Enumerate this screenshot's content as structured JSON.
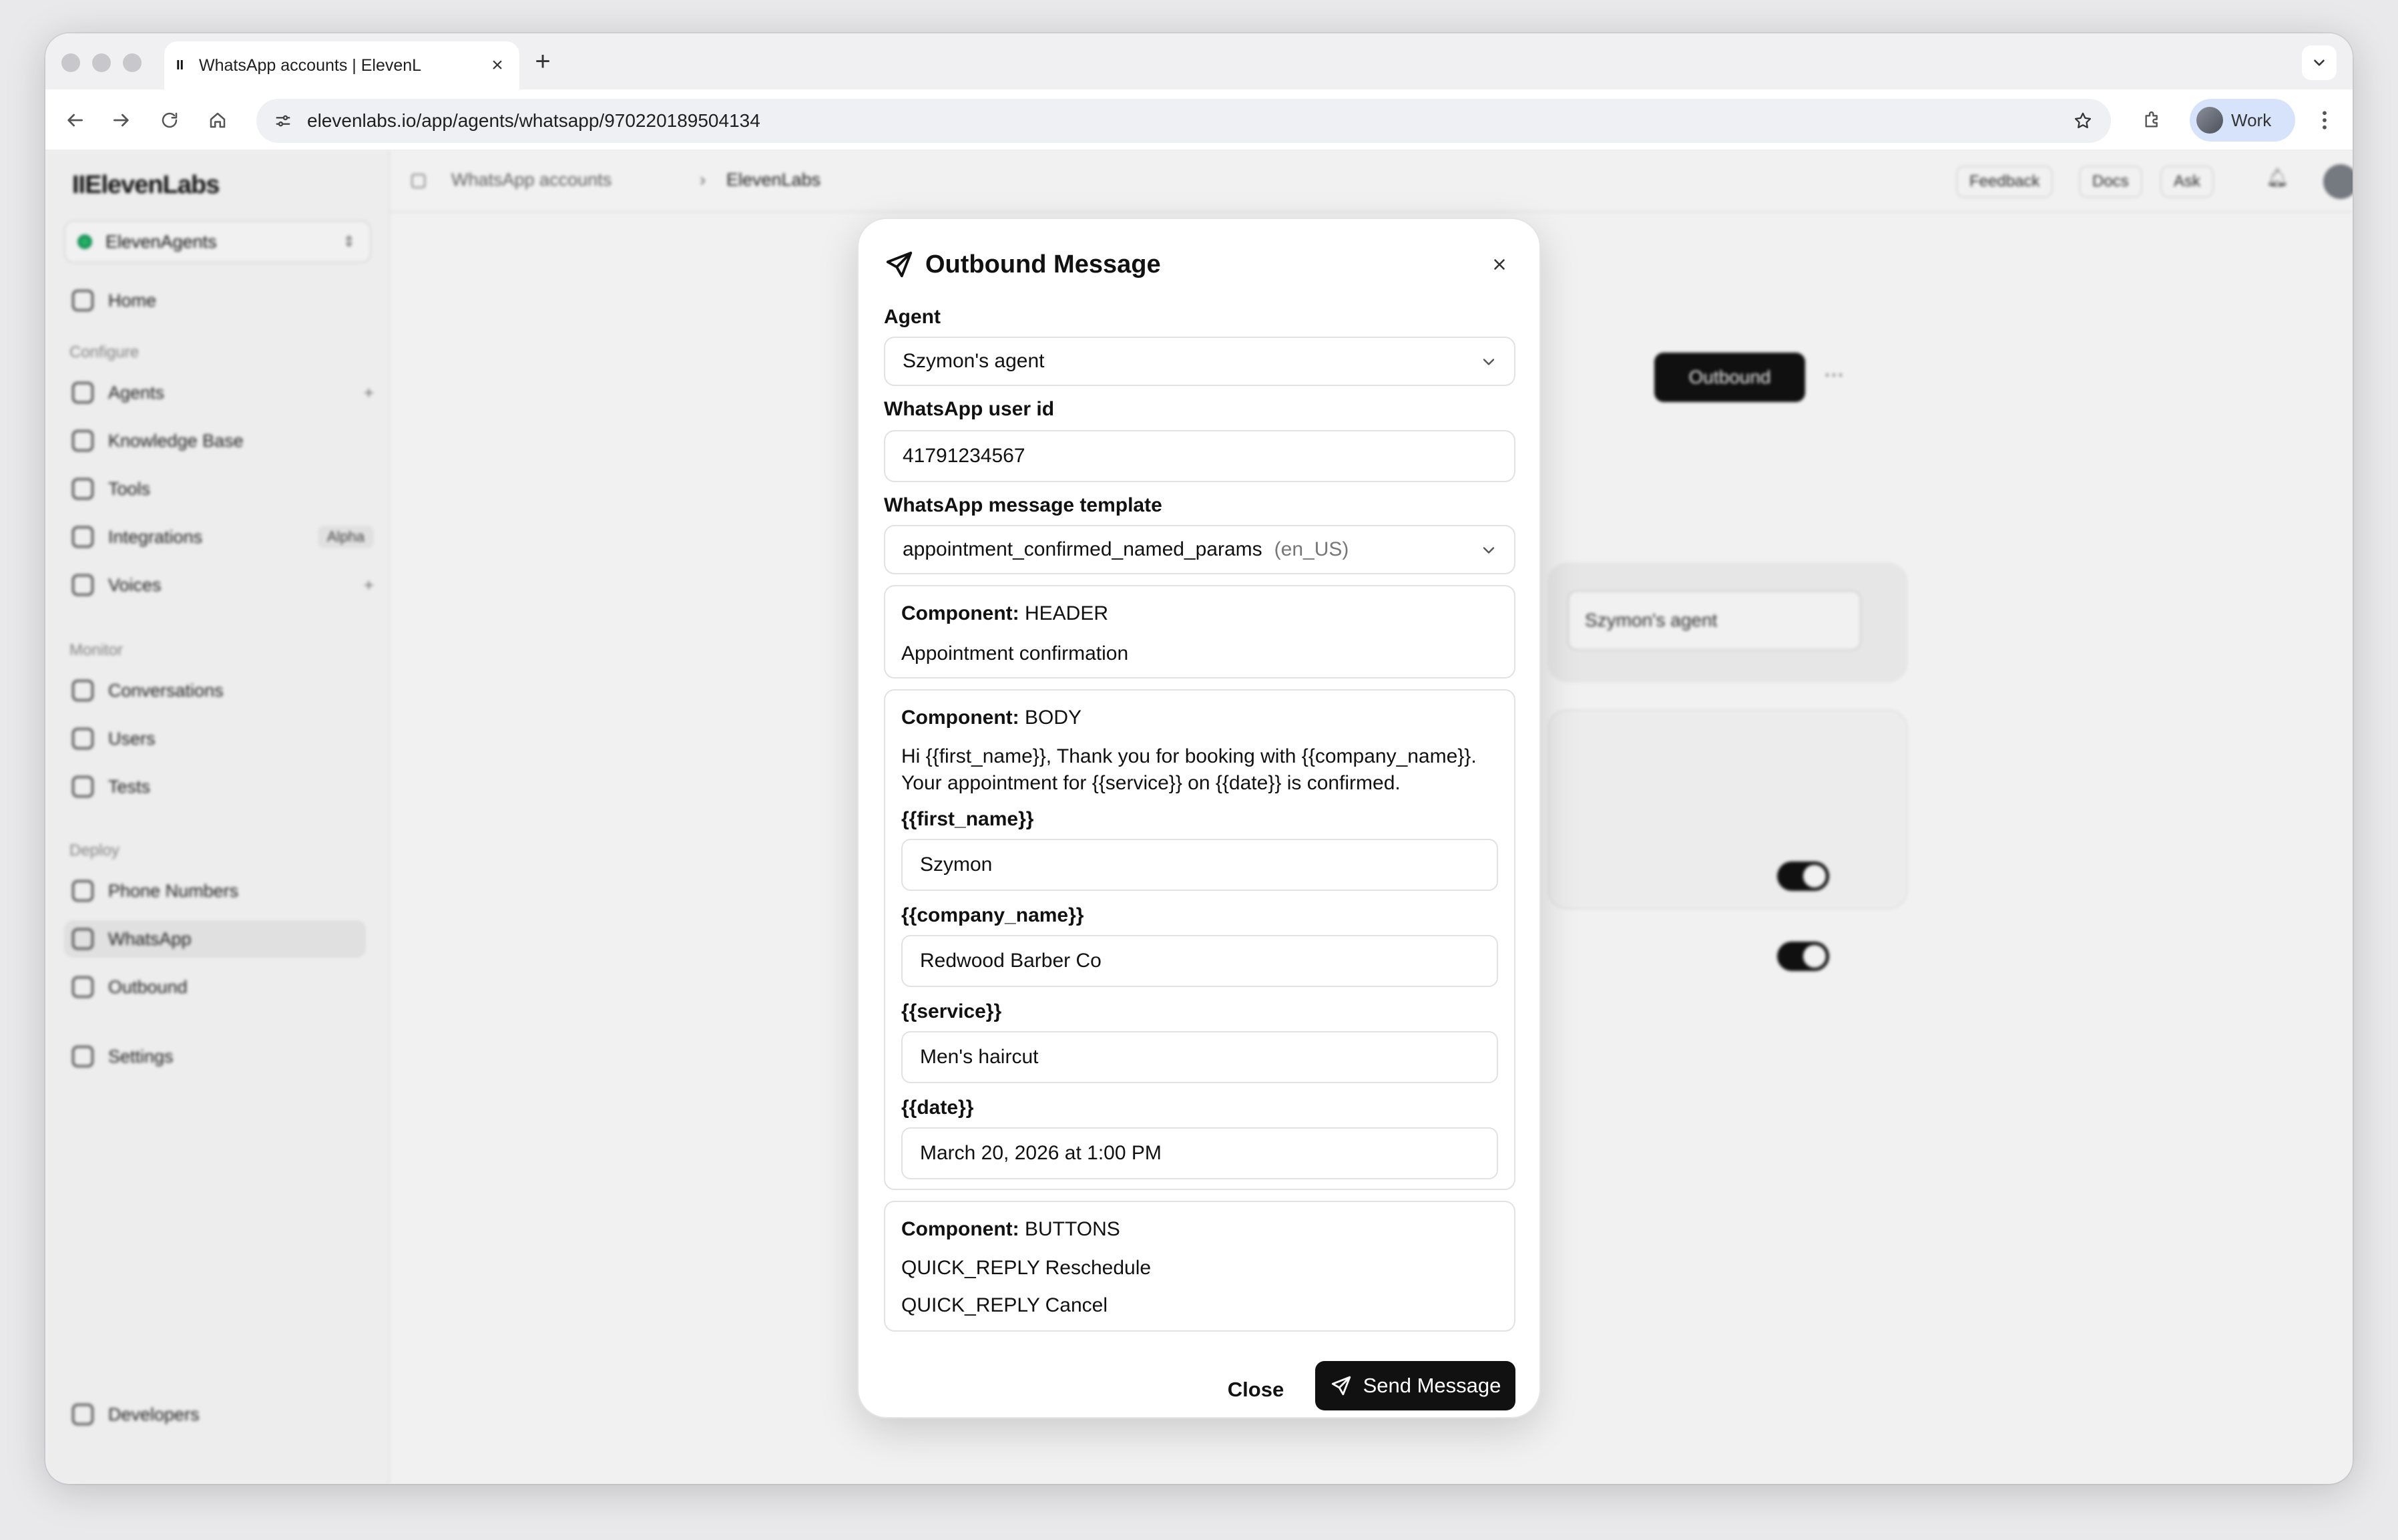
{
  "browser": {
    "tab_title": "WhatsApp accounts | ElevenL",
    "tab_favicon": "II",
    "url": "elevenlabs.io/app/agents/whatsapp/970220189504134",
    "profile_label": "Work"
  },
  "sidebar": {
    "logo": "IIElevenLabs",
    "workspace": "ElevenAgents",
    "home": "Home",
    "section_configure": "Configure",
    "configure_items": [
      "Agents",
      "Knowledge Base",
      "Tools",
      "Integrations",
      "Voices"
    ],
    "integrations_badge": "Alpha",
    "section_monitor": "Monitor",
    "monitor_items": [
      "Conversations",
      "Users",
      "Tests"
    ],
    "section_deploy": "Deploy",
    "deploy_items": [
      "Phone Numbers",
      "WhatsApp",
      "Outbound"
    ],
    "settings": "Settings",
    "developers": "Developers"
  },
  "topnav": {
    "crumb_1": "WhatsApp accounts",
    "crumb_sep": "›",
    "crumb_2": "ElevenLabs",
    "feedback": "Feedback",
    "docs": "Docs",
    "ask": "Ask"
  },
  "background": {
    "outbound_button": "Outbound",
    "agent_select": "Szymon's agent"
  },
  "modal": {
    "title": "Outbound Message",
    "agent_label": "Agent",
    "agent_value": "Szymon's agent",
    "user_id_label": "WhatsApp user id",
    "user_id_value": "41791234567",
    "template_label": "WhatsApp message template",
    "template_value": "appointment_confirmed_named_params",
    "template_locale": "(en_US)",
    "component_prefix": "Component:",
    "header_component": {
      "type": "HEADER",
      "text": "Appointment confirmation"
    },
    "body_component": {
      "type": "BODY",
      "text_line_1": "Hi {{first_name}}, Thank you for booking with {{company_name}}.",
      "text_line_2": "Your appointment for {{service}} on {{date}} is confirmed.",
      "variables": [
        {
          "label": "{{first_name}}",
          "value": "Szymon"
        },
        {
          "label": "{{company_name}}",
          "value": "Redwood Barber Co"
        },
        {
          "label": "{{service}}",
          "value": "Men's haircut"
        },
        {
          "label": "{{date}}",
          "value": "March 20, 2026 at 1:00 PM"
        }
      ]
    },
    "buttons_component": {
      "type": "BUTTONS",
      "items": [
        "QUICK_REPLY Reschedule",
        "QUICK_REPLY Cancel"
      ]
    },
    "close_label": "Close",
    "send_label": "Send Message"
  }
}
